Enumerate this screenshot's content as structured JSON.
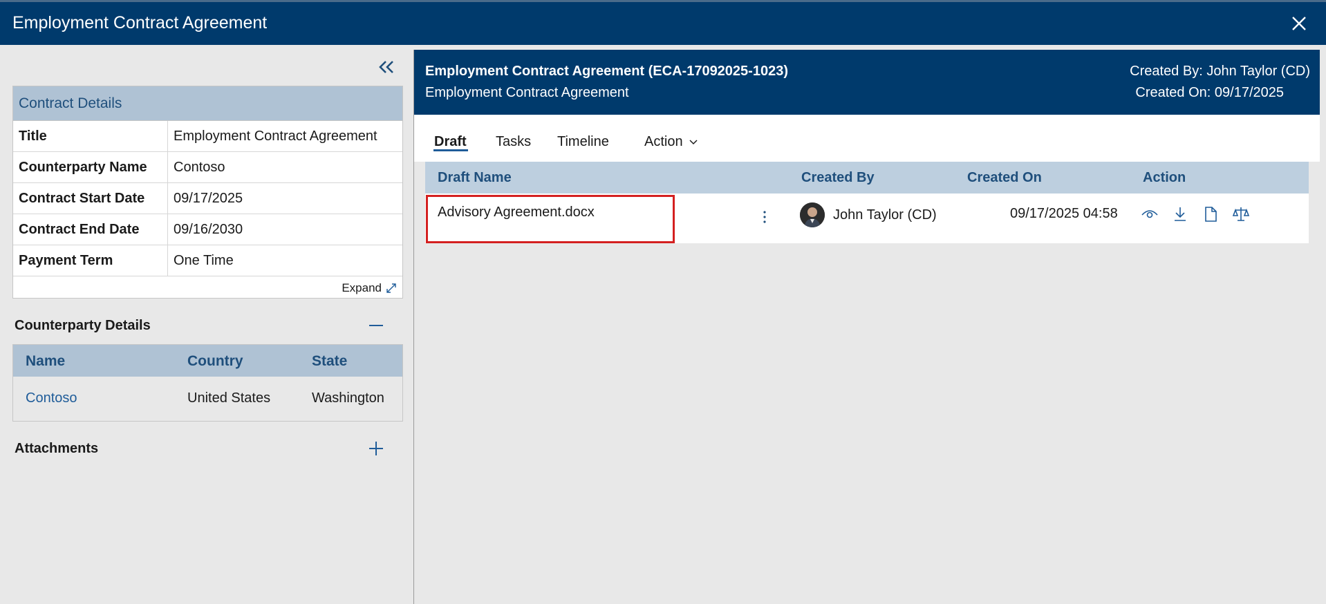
{
  "window": {
    "title": "Employment Contract Agreement"
  },
  "contract_details": {
    "header": "Contract Details",
    "rows": [
      {
        "label": "Title",
        "value": "Employment Contract Agreement"
      },
      {
        "label": "Counterparty Name",
        "value": "Contoso"
      },
      {
        "label": "Contract Start Date",
        "value": "09/17/2025"
      },
      {
        "label": "Contract End Date",
        "value": "09/16/2030"
      },
      {
        "label": "Payment Term",
        "value": "One Time"
      }
    ],
    "expand_label": "Expand"
  },
  "counterparty_details": {
    "title": "Counterparty Details",
    "columns": [
      "Name",
      "Country",
      "State"
    ],
    "rows": [
      {
        "name": "Contoso",
        "country": "United States",
        "state": "Washington"
      }
    ]
  },
  "attachments": {
    "title": "Attachments"
  },
  "right_header": {
    "title": "Employment Contract Agreement (ECA-17092025-1023)",
    "subtitle": "Employment Contract Agreement",
    "created_by": "Created By: John Taylor (CD)",
    "created_on": "Created On: 09/17/2025"
  },
  "tabs": [
    "Draft",
    "Tasks",
    "Timeline",
    "Action"
  ],
  "active_tab": "Draft",
  "draft_table": {
    "columns": [
      "Draft Name",
      "Created By",
      "Created On",
      "Action"
    ],
    "rows": [
      {
        "draft_name": "Advisory Agreement.docx",
        "created_by": "John Taylor (CD)",
        "created_on": "09/17/2025 04:58"
      }
    ]
  },
  "icons": [
    "close-icon",
    "double-chevron-left-icon",
    "expand-icon",
    "minus-icon",
    "plus-icon",
    "chevron-down-icon",
    "more-vertical-icon",
    "eye-icon",
    "download-icon",
    "document-icon",
    "scales-icon"
  ],
  "colors": {
    "brand": "#003a6c",
    "header_fill": "#afc2d4",
    "link": "#1f5c99",
    "highlight": "#d42020"
  }
}
